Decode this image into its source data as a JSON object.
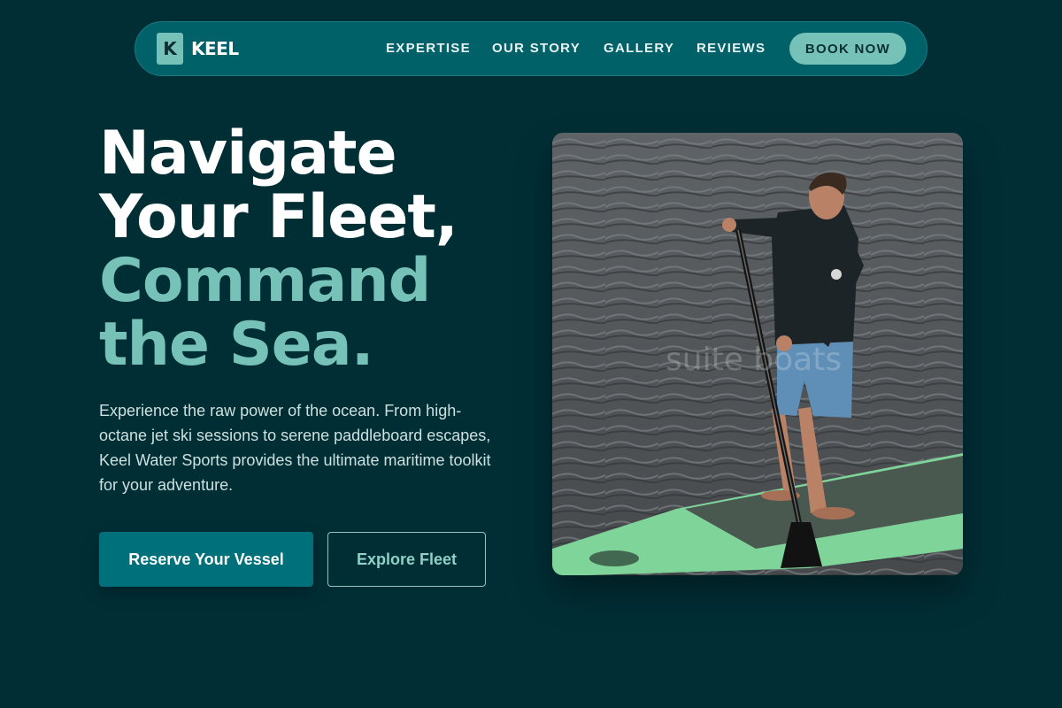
{
  "brand": {
    "mark": "K",
    "name": "KEEL"
  },
  "nav": {
    "links": [
      {
        "label": "EXPERTISE"
      },
      {
        "label": "OUR STORY"
      },
      {
        "label": "GALLERY"
      },
      {
        "label": "REVIEWS"
      }
    ],
    "cta": "BOOK NOW"
  },
  "hero": {
    "headline_line1": "Navigate",
    "headline_line2": "Your Fleet,",
    "headline_line3": "Command",
    "headline_line4": "the Sea.",
    "description": "Experience the raw power of the ocean. From high-octane jet ski sessions to serene paddleboard escapes, Keel Water Sports provides the ultimate maritime toolkit for your adventure.",
    "primary_button": "Reserve Your Vessel",
    "secondary_button": "Explore Fleet",
    "image_watermark": "suite boats"
  },
  "colors": {
    "background": "#002e35",
    "nav_background": "#006169",
    "accent": "#76c2b9",
    "primary_button": "#00707a"
  },
  "icons": {
    "logo": "keel-logo-mark"
  }
}
